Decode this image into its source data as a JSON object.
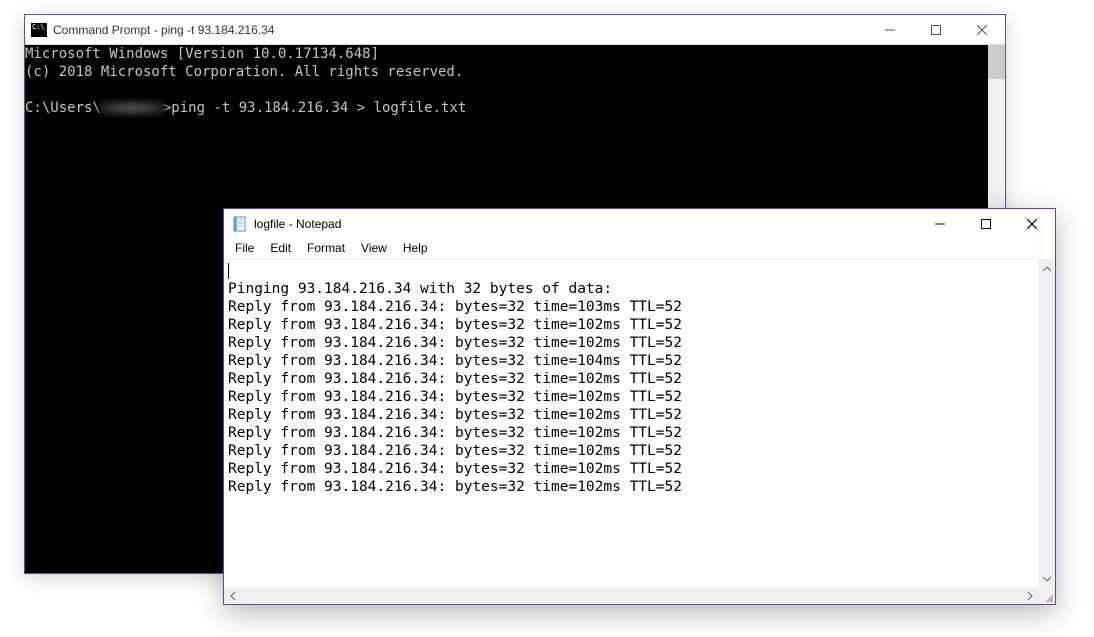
{
  "cmd": {
    "title": "Command Prompt - ping  -t 93.184.216.34",
    "header1": "Microsoft Windows [Version 10.0.17134.648]",
    "header2": "(c) 2018 Microsoft Corporation. All rights reserved.",
    "prompt_prefix": "C:\\Users\\",
    "prompt_suffix": ">ping -t 93.184.216.34 > logfile.txt"
  },
  "notepad": {
    "title": "logfile - Notepad",
    "menu": {
      "file": "File",
      "edit": "Edit",
      "format": "Format",
      "view": "View",
      "help": "Help"
    },
    "lines": [
      "",
      "Pinging 93.184.216.34 with 32 bytes of data:",
      "Reply from 93.184.216.34: bytes=32 time=103ms TTL=52",
      "Reply from 93.184.216.34: bytes=32 time=102ms TTL=52",
      "Reply from 93.184.216.34: bytes=32 time=102ms TTL=52",
      "Reply from 93.184.216.34: bytes=32 time=104ms TTL=52",
      "Reply from 93.184.216.34: bytes=32 time=102ms TTL=52",
      "Reply from 93.184.216.34: bytes=32 time=102ms TTL=52",
      "Reply from 93.184.216.34: bytes=32 time=102ms TTL=52",
      "Reply from 93.184.216.34: bytes=32 time=102ms TTL=52",
      "Reply from 93.184.216.34: bytes=32 time=102ms TTL=52",
      "Reply from 93.184.216.34: bytes=32 time=102ms TTL=52",
      "Reply from 93.184.216.34: bytes=32 time=102ms TTL=52"
    ]
  }
}
